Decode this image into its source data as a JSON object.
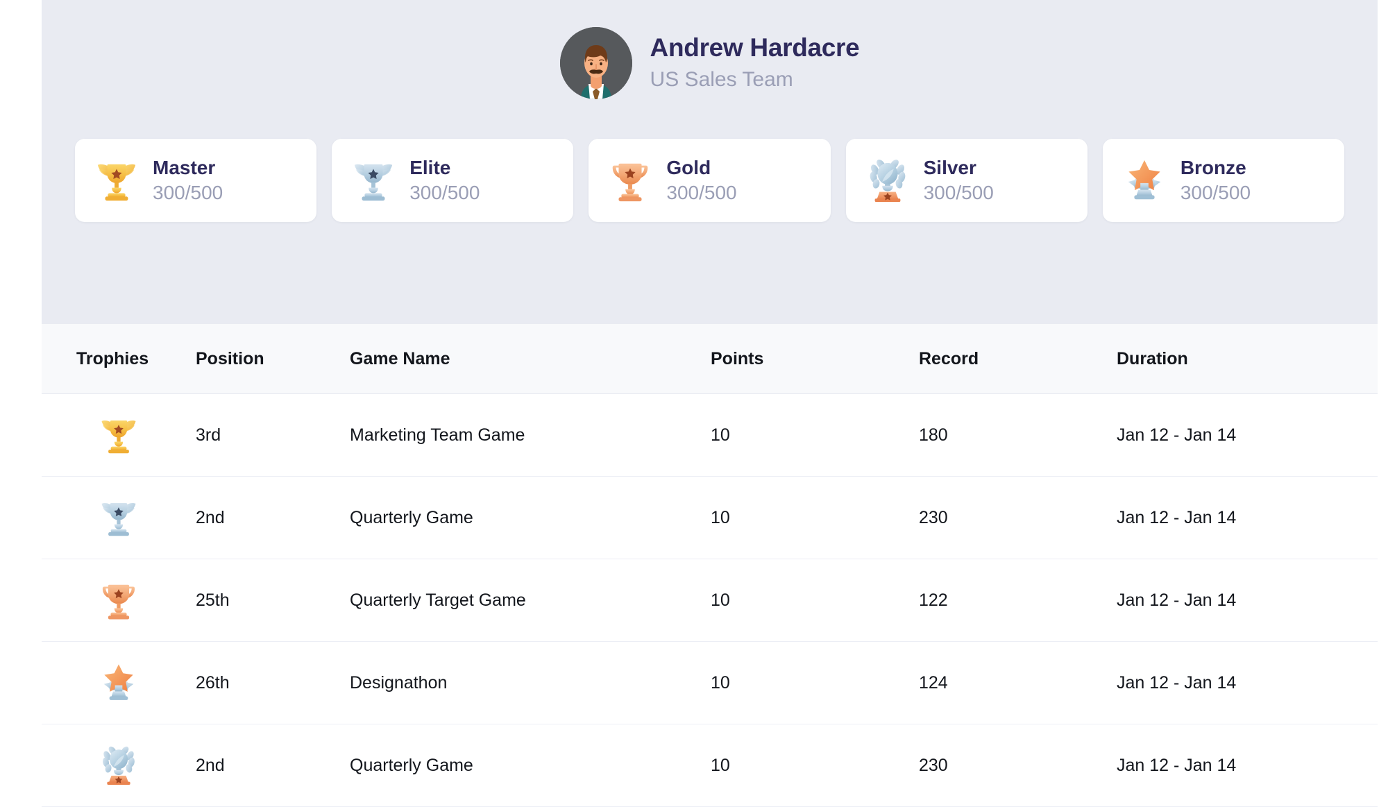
{
  "profile": {
    "name": "Andrew Hardacre",
    "team": "US Sales Team",
    "avatar_icon": "user-avatar-illustration"
  },
  "badges": [
    {
      "id": "master",
      "label": "Master",
      "progress": "300/500",
      "icon": "winged-trophy-gold-icon",
      "color": "#f5b840"
    },
    {
      "id": "elite",
      "label": "Elite",
      "progress": "300/500",
      "icon": "winged-trophy-silver-icon",
      "color": "#a9c6dc"
    },
    {
      "id": "gold",
      "label": "Gold",
      "progress": "300/500",
      "icon": "handled-trophy-bronze-icon",
      "color": "#f0a06a"
    },
    {
      "id": "silver",
      "label": "Silver",
      "progress": "300/500",
      "icon": "laurel-trophy-silver-icon",
      "color": "#a9c6dc"
    },
    {
      "id": "bronze",
      "label": "Bronze",
      "progress": "300/500",
      "icon": "star-ribbon-trophy-icon",
      "color": "#f08a4b"
    }
  ],
  "table": {
    "headers": [
      "Trophies",
      "Position",
      "Game Name",
      "Points",
      "Record",
      "Duration"
    ],
    "rows": [
      {
        "trophy_icon": "winged-trophy-gold-icon",
        "position": "3rd",
        "game_name": "Marketing Team Game",
        "points": "10",
        "record": "180",
        "duration": "Jan 12 - Jan 14"
      },
      {
        "trophy_icon": "winged-trophy-silver-icon",
        "position": "2nd",
        "game_name": "Quarterly Game",
        "points": "10",
        "record": "230",
        "duration": "Jan 12 - Jan 14"
      },
      {
        "trophy_icon": "handled-trophy-bronze-icon",
        "position": "25th",
        "game_name": "Quarterly Target Game",
        "points": "10",
        "record": "122",
        "duration": "Jan 12 - Jan 14"
      },
      {
        "trophy_icon": "star-ribbon-trophy-icon",
        "position": "26th",
        "game_name": "Designathon",
        "points": "10",
        "record": "124",
        "duration": "Jan 12 - Jan 14"
      },
      {
        "trophy_icon": "laurel-trophy-silver-icon",
        "position": "2nd",
        "game_name": "Quarterly Game",
        "points": "10",
        "record": "230",
        "duration": "Jan 12 - Jan 14"
      }
    ]
  },
  "colors": {
    "band_bg": "#e9ebf2",
    "card_bg": "#ffffff",
    "title_text": "#2e2a5c",
    "muted_text": "#9a9eb5",
    "table_header_bg": "#f8f9fb",
    "row_border": "#eceef5"
  }
}
